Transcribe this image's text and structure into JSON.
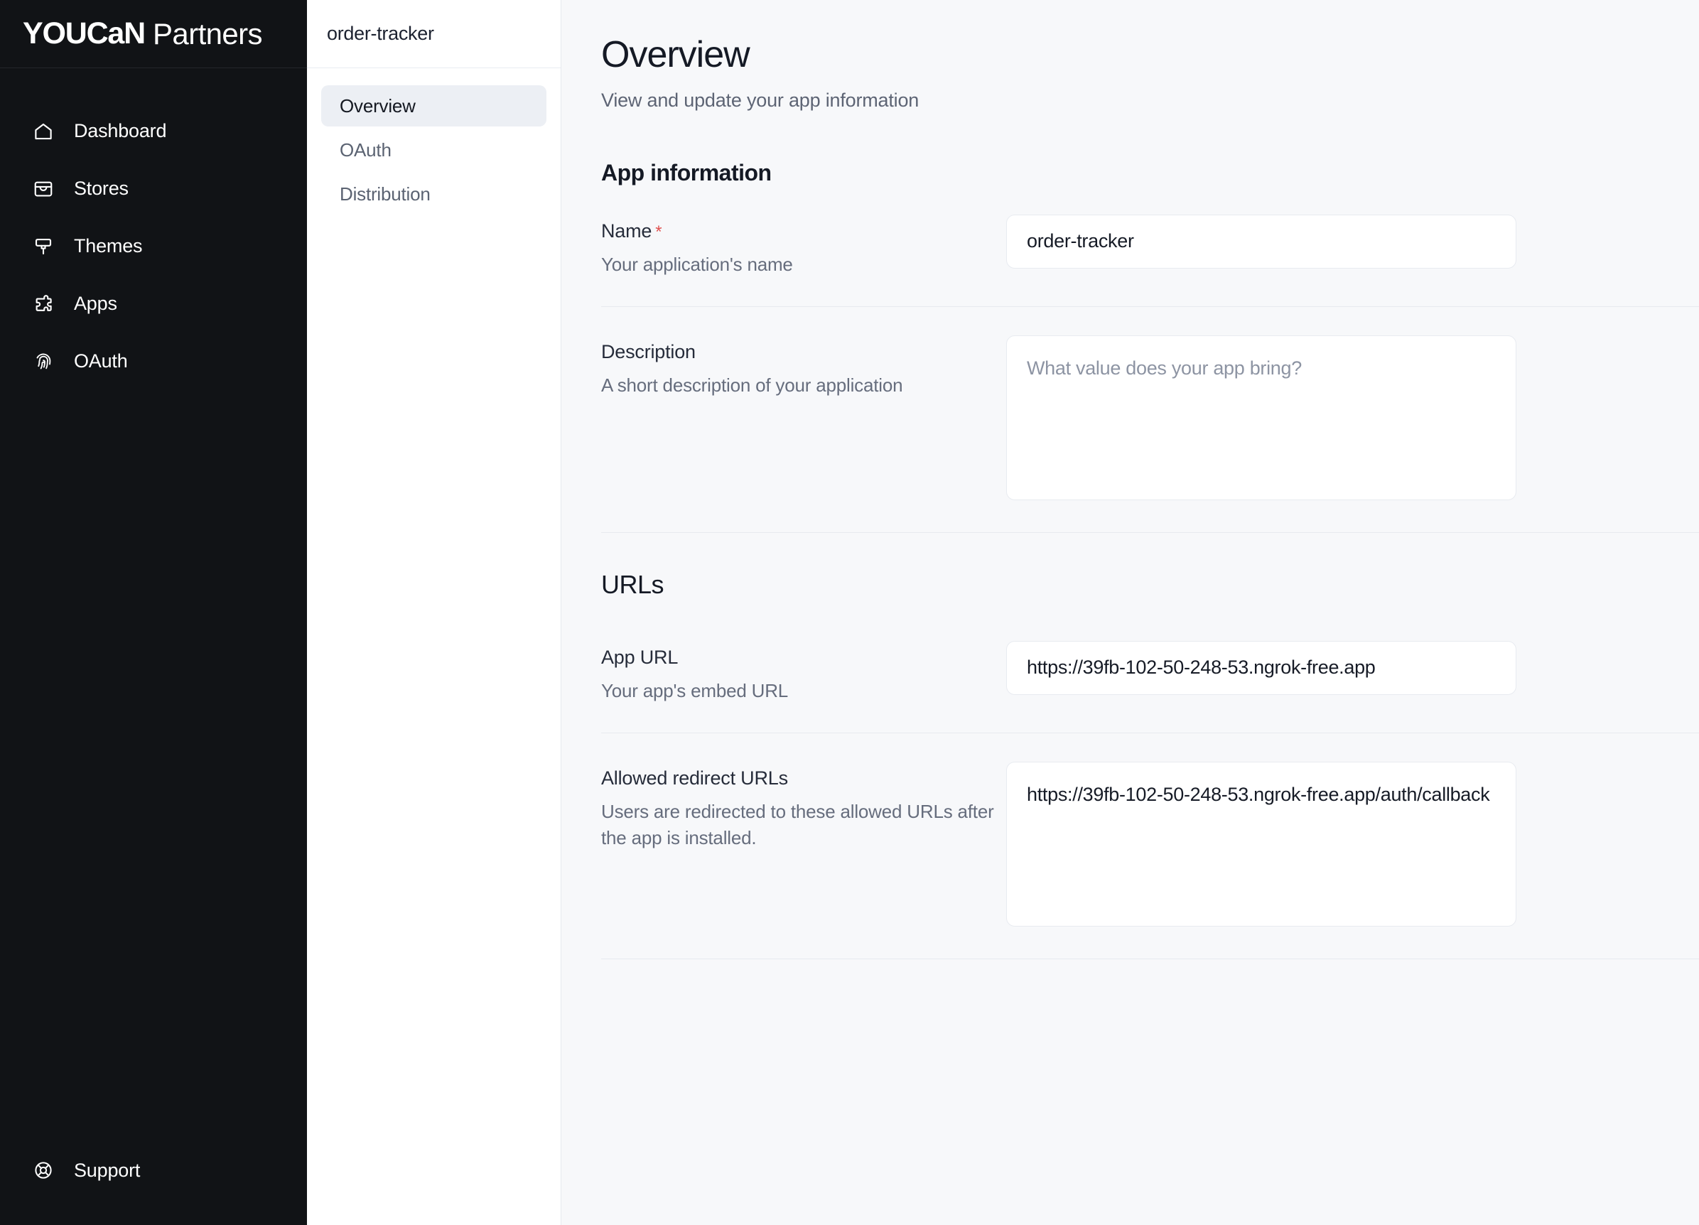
{
  "brand": {
    "mark": "YOUCaN",
    "sub": "Partners"
  },
  "sidebar": {
    "items": [
      {
        "label": "Dashboard",
        "icon": "home-icon"
      },
      {
        "label": "Stores",
        "icon": "storefront-icon"
      },
      {
        "label": "Themes",
        "icon": "paint-brush-icon"
      },
      {
        "label": "Apps",
        "icon": "puzzle-piece-icon"
      },
      {
        "label": "OAuth",
        "icon": "fingerprint-icon"
      }
    ],
    "support": {
      "label": "Support",
      "icon": "lifebuoy-icon"
    }
  },
  "subnav": {
    "title": "order-tracker",
    "items": [
      {
        "label": "Overview",
        "active": true
      },
      {
        "label": "OAuth",
        "active": false
      },
      {
        "label": "Distribution",
        "active": false
      }
    ]
  },
  "page": {
    "title": "Overview",
    "subtitle": "View and update your app information"
  },
  "app_information": {
    "heading": "App information",
    "name": {
      "label": "Name",
      "required_marker": "*",
      "hint": "Your application's name",
      "value": "order-tracker",
      "placeholder": ""
    },
    "description": {
      "label": "Description",
      "hint": "A short description of your application",
      "value": "",
      "placeholder": "What value does your app bring?"
    }
  },
  "urls": {
    "heading": "URLs",
    "app_url": {
      "label": "App URL",
      "hint": "Your app's embed URL",
      "value": "https://39fb-102-50-248-53.ngrok-free.app",
      "placeholder": ""
    },
    "redirect_urls": {
      "label": "Allowed redirect URLs",
      "hint": "Users are redirected to these allowed URLs after the app is installed.",
      "value": "https://39fb-102-50-248-53.ngrok-free.app/auth/callback",
      "placeholder": ""
    }
  },
  "colors": {
    "sidebar_bg": "#111316",
    "main_bg": "#f7f8fa",
    "panel_bg": "#ffffff",
    "active_item_bg": "#eceff4",
    "required_red": "#e0514f",
    "text_primary": "#151a25",
    "text_muted": "#5d6474"
  }
}
